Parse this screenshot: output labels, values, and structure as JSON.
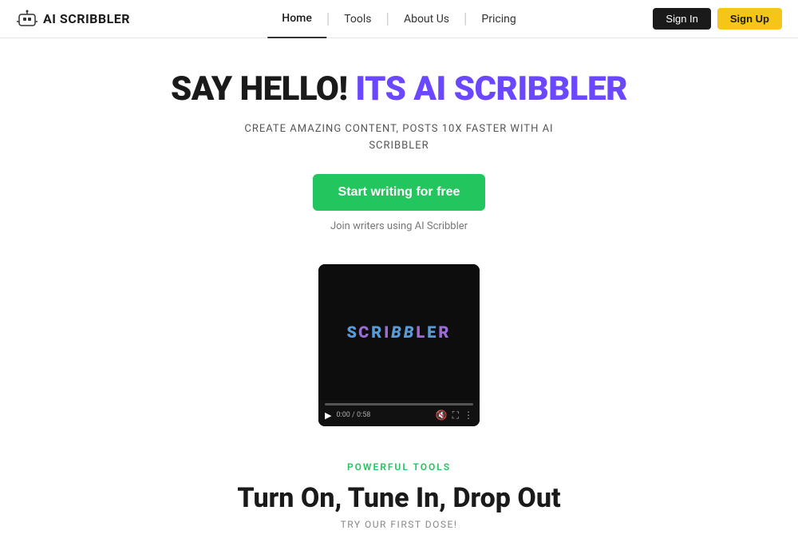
{
  "navbar": {
    "logo_icon_alt": "AI Scribbler logo robot icon",
    "logo_text": "AI SCRIBBLER",
    "nav_links": [
      {
        "label": "Home",
        "active": true
      },
      {
        "label": "Tools",
        "active": false
      },
      {
        "label": "About Us",
        "active": false
      },
      {
        "label": "Pricing",
        "active": false
      }
    ],
    "btn_signin": "Sign In",
    "btn_signup": "Sign Up"
  },
  "hero": {
    "title_black": "SAY HELLO!",
    "title_colored": " ITS AI SCRIBBLER",
    "subtitle_line1": "CREATE AMAZING CONTENT, POSTS 10X FASTER WITH AI",
    "subtitle_line2": "SCRIBBLER",
    "cta_button": "Start writing for free",
    "join_text": "Join writers using AI Scribbler"
  },
  "video": {
    "logo_text": "SCRIBBLER",
    "time": "0:00 / 0:58"
  },
  "bottom": {
    "section_label": "POWERFUL TOOLS",
    "title": "Turn On, Tune In, Drop Out",
    "subtitle": "TRY OUR FIRST DOSE!"
  },
  "colors": {
    "accent_green": "#22c55e",
    "accent_purple": "#6b48ff",
    "accent_yellow": "#f5c518",
    "dark": "#1a1a1a"
  }
}
